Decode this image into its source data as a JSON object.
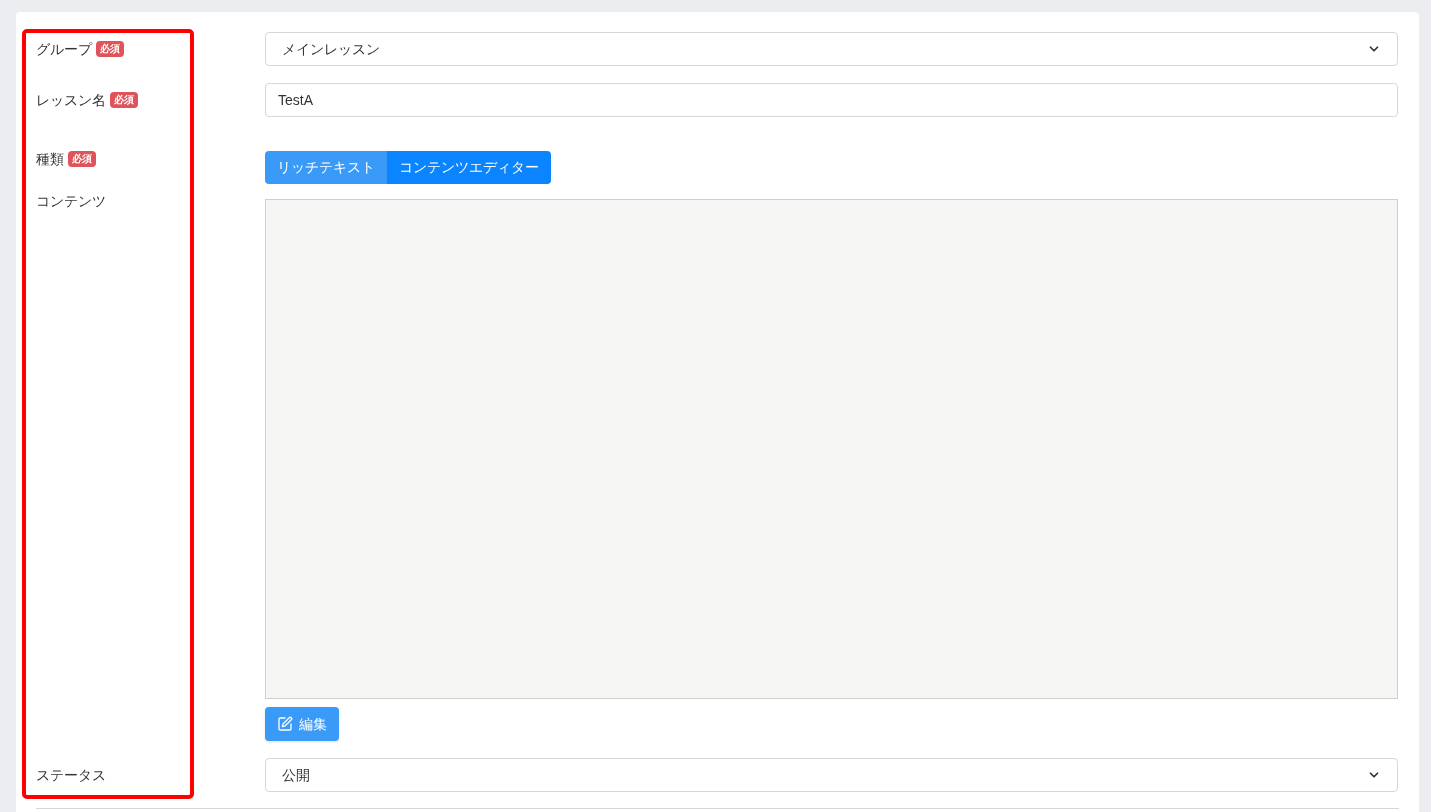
{
  "form": {
    "rows": [
      {
        "kind": "select",
        "label": "グループ",
        "badge": "必須",
        "value": "メインレッスン"
      },
      {
        "kind": "input",
        "label": "レッスン名",
        "badge": "必須",
        "value": "TestA"
      },
      {
        "kind": "toggle",
        "label": "種類",
        "badge": "必須",
        "options": [
          {
            "label": "リッチテキスト",
            "selected": false
          },
          {
            "label": "コンテンツエディター",
            "selected": true
          }
        ]
      },
      {
        "kind": "content",
        "label": "コンテンツ",
        "button": "編集"
      },
      {
        "kind": "select",
        "label": "ステータス",
        "value": "公開"
      }
    ]
  },
  "highlight": {
    "shown": true
  }
}
